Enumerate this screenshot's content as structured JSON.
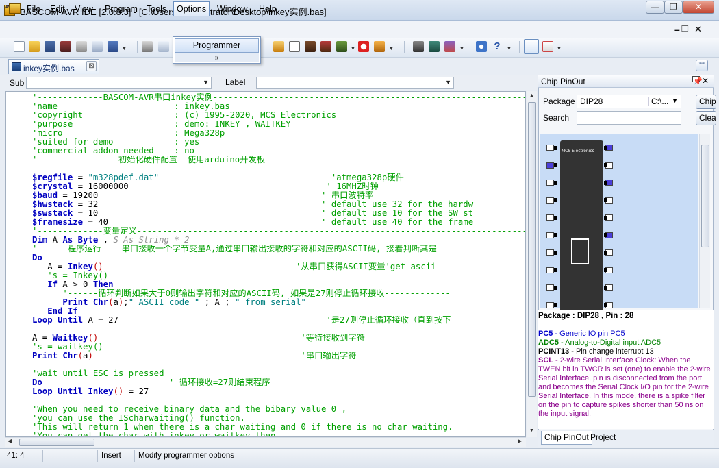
{
  "window": {
    "title": "BASCOM-AVR IDE [2.0.8.3] - [C:\\Users\\Administrator\\Desktop\\inkey实例.bas]",
    "icon_text": "AVR"
  },
  "window_controls": {
    "minimize": "—",
    "restore": "❐",
    "close": "✕"
  },
  "mdi_controls": {
    "minimize": "–",
    "restore": "❐",
    "close": "✕"
  },
  "menu": {
    "items": [
      "File",
      "Edit",
      "View",
      "Program",
      "Tools",
      "Options",
      "Window",
      "Help"
    ]
  },
  "options_dropdown": {
    "item": "Programmer",
    "more": "»"
  },
  "tab": {
    "label": "inkey实例.bas",
    "close": "⊠"
  },
  "subbar": {
    "sub_label": "Sub",
    "label_label": "Label"
  },
  "code_lines": [
    {
      "segs": [
        [
          "g",
          "'-------------BASCOM-AVR串口inkey实例--------------------------------------------------------------"
        ]
      ]
    },
    {
      "segs": [
        [
          "g",
          "'name                       : inkey.bas"
        ]
      ]
    },
    {
      "segs": [
        [
          "g",
          "'copyright                  : (c) 1995-2020, MCS Electronics"
        ]
      ]
    },
    {
      "segs": [
        [
          "g",
          "'purpose                    : demo: INKEY , WAITKEY"
        ]
      ]
    },
    {
      "segs": [
        [
          "g",
          "'micro                      : Mega328p"
        ]
      ]
    },
    {
      "segs": [
        [
          "g",
          "'suited for demo            : yes"
        ]
      ]
    },
    {
      "segs": [
        [
          "g",
          "'commercial addon needed    : no"
        ]
      ]
    },
    {
      "segs": [
        [
          "g",
          "'----------------初始化硬件配置--使用arduino开发板-------------------------------------------------------"
        ]
      ]
    },
    {
      "segs": [
        [
          "b",
          ""
        ]
      ]
    },
    {
      "segs": [
        [
          "k",
          "$regfile"
        ],
        [
          "n",
          " = "
        ],
        [
          "s",
          "\"m328pdef.dat\""
        ],
        [
          "g",
          "                                  'atmega328p硬件"
        ]
      ]
    },
    {
      "segs": [
        [
          "k",
          "$crystal"
        ],
        [
          "n",
          " = 16000000"
        ],
        [
          "g",
          "                                       ' 16MHZ时钟"
        ]
      ]
    },
    {
      "segs": [
        [
          "k",
          "$baud"
        ],
        [
          "n",
          " = 19200"
        ],
        [
          "g",
          "                                            ' 串口波特率"
        ]
      ]
    },
    {
      "segs": [
        [
          "k",
          "$hwstack"
        ],
        [
          "n",
          " = 32"
        ],
        [
          "g",
          "                                            ' default use 32 for the hardw"
        ]
      ]
    },
    {
      "segs": [
        [
          "k",
          "$swstack"
        ],
        [
          "n",
          " = 10"
        ],
        [
          "g",
          "                                            ' default use 10 for the SW st"
        ]
      ]
    },
    {
      "segs": [
        [
          "k",
          "$framesize"
        ],
        [
          "n",
          " = 40"
        ],
        [
          "g",
          "                                          ' default use 40 for the frame"
        ]
      ]
    },
    {
      "segs": [
        [
          "g",
          "'-------------变量定义-----------------------------------------------------------------------------"
        ]
      ]
    },
    {
      "segs": [
        [
          "k",
          "Dim"
        ],
        [
          "n",
          " A "
        ],
        [
          "k",
          "As Byte"
        ],
        [
          "n",
          " , "
        ],
        [
          "i",
          "S As String * 2"
        ]
      ]
    },
    {
      "segs": [
        [
          "g",
          "'------程序运行----串口接收一个字节变量A,通过串口输出接收的字符和对应的ASCII码, 接着判断其是"
        ]
      ]
    },
    {
      "segs": [
        [
          "k",
          "Do"
        ]
      ]
    },
    {
      "segs": [
        [
          "n",
          "   A = "
        ],
        [
          "k",
          "Inkey"
        ],
        [
          "r",
          "()"
        ],
        [
          "g",
          "                                      '从串口获得ASCII变量'get ascii"
        ]
      ]
    },
    {
      "segs": [
        [
          "g",
          "   's = Inkey()"
        ]
      ]
    },
    {
      "segs": [
        [
          "n",
          "   "
        ],
        [
          "k",
          "If"
        ],
        [
          "n",
          " A > 0 "
        ],
        [
          "k",
          "Then"
        ]
      ]
    },
    {
      "segs": [
        [
          "g",
          "      '------循环判断如果大于0则输出字符和对应的ASCII码, 如果是27则停止循环接收-------------"
        ]
      ]
    },
    {
      "segs": [
        [
          "n",
          "      "
        ],
        [
          "k",
          "Print Chr"
        ],
        [
          "r",
          "("
        ],
        [
          "n",
          "a"
        ],
        [
          "r",
          ")"
        ],
        [
          "n",
          ";"
        ],
        [
          "s",
          "\" ASCII code \""
        ],
        [
          "n",
          " ; A ; "
        ],
        [
          "s",
          "\" from serial\""
        ]
      ]
    },
    {
      "segs": [
        [
          "n",
          "   "
        ],
        [
          "k",
          "End If"
        ]
      ]
    },
    {
      "segs": [
        [
          "k",
          "Loop Until"
        ],
        [
          "n",
          " A = 27"
        ],
        [
          "g",
          "                                         '是27则停止循环接收（直到按下"
        ]
      ]
    },
    {
      "segs": [
        [
          "b",
          ""
        ]
      ]
    },
    {
      "segs": [
        [
          "n",
          "A = "
        ],
        [
          "k",
          "Waitkey"
        ],
        [
          "r",
          "()"
        ],
        [
          "g",
          "                                        '等待接收到字符"
        ]
      ]
    },
    {
      "segs": [
        [
          "g",
          "'s = waitkey()"
        ]
      ]
    },
    {
      "segs": [
        [
          "k",
          "Print Chr"
        ],
        [
          "r",
          "("
        ],
        [
          "n",
          "a"
        ],
        [
          "r",
          ")"
        ],
        [
          "g",
          "                                         '串口输出字符"
        ]
      ]
    },
    {
      "segs": [
        [
          "b",
          ""
        ]
      ]
    },
    {
      "segs": [
        [
          "g",
          "'wait until ESC is pressed"
        ]
      ]
    },
    {
      "segs": [
        [
          "k",
          "Do"
        ],
        [
          "g",
          "                         ' 循环接收=27则结束程序"
        ]
      ]
    },
    {
      "segs": [
        [
          "k",
          "Loop Until Inkey"
        ],
        [
          "r",
          "()"
        ],
        [
          "n",
          " = 27"
        ]
      ]
    },
    {
      "segs": [
        [
          "b",
          ""
        ]
      ]
    },
    {
      "segs": [
        [
          "g",
          "'When you need to receive binary data and the bibary value 0 ,"
        ]
      ]
    },
    {
      "segs": [
        [
          "g",
          "'you can use the IScharwaiting() function."
        ]
      ]
    },
    {
      "segs": [
        [
          "g",
          "'This will return 1 when there is a char waiting and 0 if there is no char waiting."
        ]
      ]
    },
    {
      "segs": [
        [
          "g",
          "'You can get the char with inkey or waitkey then."
        ]
      ]
    }
  ],
  "chip_pinout": {
    "title": "Chip PinOut",
    "pin_icon": "📌",
    "close": "✕",
    "package_label": "Package",
    "package_value": "DIP28",
    "path_value": "C:\\...",
    "search_label": "Search",
    "chip_button": "Chip",
    "clear_button": "Clear",
    "chip_text": "MCS Electronics",
    "header": "Package : DIP28 , Pin : 28",
    "pins": [
      {
        "name": "PC5",
        "desc": " - Generic IO pin PC5",
        "color": "#0000cc"
      },
      {
        "name": "ADC5",
        "desc": " - Analog-to-Digital input ADC5",
        "color": "#008000"
      },
      {
        "name": "PCINT13",
        "desc": " - Pin change interrupt 13",
        "color": "#000000"
      },
      {
        "name": "SCL",
        "desc": " - 2-wire Serial Interface Clock: When the TWEN bit in TWCR is set (one) to enable the 2-wire Serial Interface, pin is disconnected from the port and becomes the Serial Clock I/O pin for the 2-wire Serial Interface. In this mode, there is a spike filter on the pin to capture spikes shorter than 50 ns on the input signal.",
        "color": "#8b008b"
      }
    ],
    "tabs": [
      "Chip PinOut",
      "Project"
    ]
  },
  "status": {
    "position": "41: 4",
    "mode": "Insert",
    "message": "Modify programmer options"
  },
  "colors": {
    "comment": "#00a000",
    "keyword": "#0000c0",
    "string": "#008080",
    "chip_bg": "#c8dcf6"
  }
}
